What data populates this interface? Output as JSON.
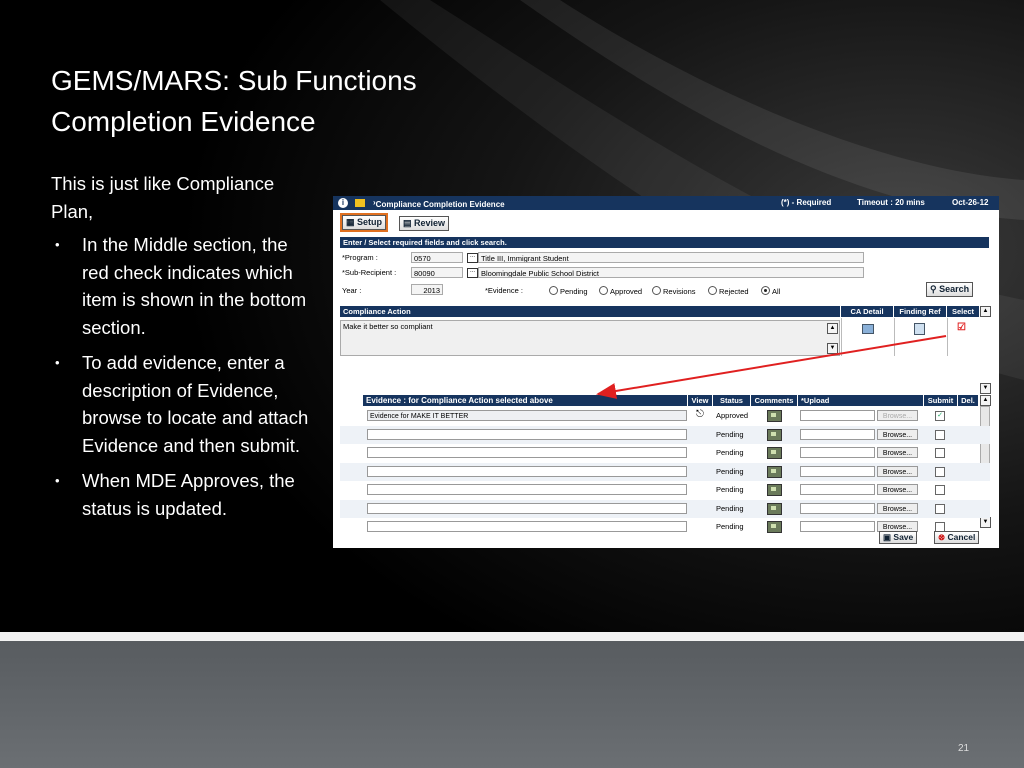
{
  "slide": {
    "title_line1": "GEMS/MARS: Sub Functions",
    "title_line2": "Completion Evidence",
    "intro": "This is just like Compliance Plan,",
    "bullets": [
      "In the Middle section, the red check indicates which item is shown in the bottom section.",
      "To add evidence, enter a description of Evidence, browse to locate and attach Evidence and then submit.",
      "When MDE Approves, the status is updated."
    ],
    "bullet_glyph": "•",
    "page_number": "21"
  },
  "app": {
    "breadcrumb": "Compliance Completion Evidence",
    "required_note": "(*) - Required",
    "timeout": "Timeout : 20 mins",
    "date": "Oct-26-12",
    "setup_label": "Setup",
    "review_label": "Review",
    "search_header": "Enter / Select required fields and click search.",
    "program_label": "*Program :",
    "program_code": "0570",
    "program_name": "Title III, Immigrant Student",
    "subrecipient_label": "*Sub-Recipient :",
    "subrecipient_code": "80090",
    "subrecipient_name": "Bloomingdale Public School District",
    "year_label": "Year :",
    "year_value": "2013",
    "evidence_label": "*Evidence :",
    "evidence_options": [
      "Pending",
      "Approved",
      "Revisions",
      "Rejected",
      "All"
    ],
    "evidence_selected": "All",
    "search_label": "Search",
    "compliance": {
      "header": "Compliance Action",
      "ca_detail": "CA Detail",
      "finding_ref": "Finding Ref",
      "select": "Select",
      "row_text": "Make it better so compliant"
    },
    "evidence_grid": {
      "header": "Evidence : for Compliance Action selected above",
      "col_view": "View",
      "col_status": "Status",
      "col_comments": "Comments",
      "col_upload": "*Upload",
      "col_submit": "Submit",
      "col_del": "Del.",
      "browse_label": "Browse...",
      "rows": [
        {
          "description": "Evidence for MAKE IT BETTER",
          "status": "Approved",
          "submitted": true
        },
        {
          "description": "",
          "status": "Pending",
          "submitted": false
        },
        {
          "description": "",
          "status": "Pending",
          "submitted": false
        },
        {
          "description": "",
          "status": "Pending",
          "submitted": false
        },
        {
          "description": "",
          "status": "Pending",
          "submitted": false
        },
        {
          "description": "",
          "status": "Pending",
          "submitted": false
        },
        {
          "description": "",
          "status": "Pending",
          "submitted": false
        }
      ]
    },
    "save_label": "Save",
    "cancel_label": "Cancel"
  },
  "colors": {
    "header_navy": "#16345e",
    "annotation_red": "#e02020"
  }
}
